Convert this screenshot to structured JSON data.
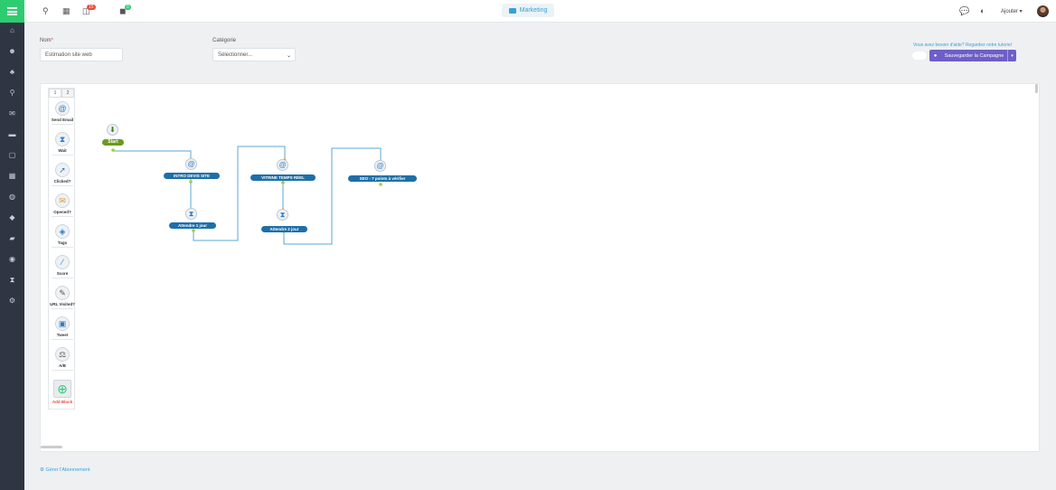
{
  "topbar": {
    "search_icon": "search-icon",
    "calendar_icon": "calendar-icon",
    "notifications_badge": "15",
    "tasks_badge": "0",
    "module_name": "Marketing",
    "add_menu_label": "Ajouter"
  },
  "form": {
    "name_label": "Nom",
    "name_value": "Estimation site web",
    "category_label": "Catégorie",
    "category_value": "Sélectionner...",
    "help_text": "Vous avez besoin d'aide? Regardez notre tutoriel",
    "save_label": "Sauvegarder la Campagne"
  },
  "toolbox": {
    "tabs": [
      "1",
      "2"
    ],
    "tools": [
      {
        "label": "Send Email",
        "icon": "at-icon"
      },
      {
        "label": "Wait",
        "icon": "hourglass-icon"
      },
      {
        "label": "Clicked?",
        "icon": "cursor-icon"
      },
      {
        "label": "Opened?",
        "icon": "envelope-icon"
      },
      {
        "label": "Tags",
        "icon": "tag-icon"
      },
      {
        "label": "Score",
        "icon": "score-icon"
      },
      {
        "label": "URL Visited?",
        "icon": "link-icon"
      },
      {
        "label": "Tweet",
        "icon": "tweet-icon"
      },
      {
        "label": "A/B",
        "icon": "split-icon"
      },
      {
        "label": "Add Block",
        "icon": "add-block-icon"
      }
    ]
  },
  "flow": {
    "start_label": "Start",
    "nodes": [
      {
        "label": "INTRO DEVIS SITE"
      },
      {
        "label": "Attendre 1 jour"
      },
      {
        "label": "VITRINE TEMPS RÉEL"
      },
      {
        "label": "Attendre 2 jour"
      },
      {
        "label": "SEO - 7 points à vérifier"
      }
    ]
  },
  "footer": {
    "subscription_link": "Gérer l'Abonnement"
  },
  "colors": {
    "sidebar": "#2f3542",
    "accent_green": "#2ecc71",
    "save_button": "#6c5fc7",
    "node_blue": "#1e6fa8",
    "start_green": "#6a9a1f",
    "link_blue": "#3aa0d8"
  }
}
